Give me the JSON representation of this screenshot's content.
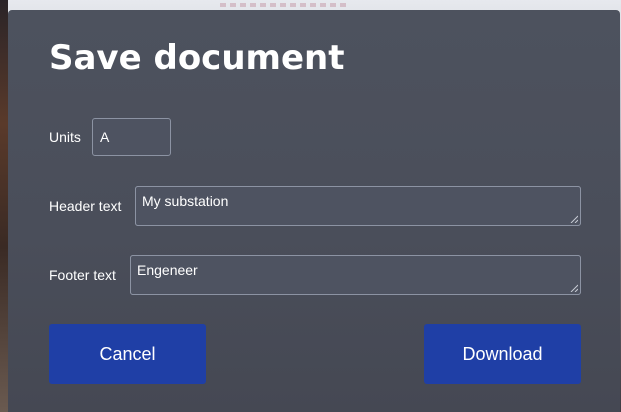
{
  "dialog": {
    "title": "Save document",
    "units": {
      "label": "Units",
      "value": "A"
    },
    "header_text": {
      "label": "Header text",
      "value": "My substation"
    },
    "footer_text": {
      "label": "Footer text",
      "value": "Engeneer"
    },
    "buttons": {
      "cancel": "Cancel",
      "download": "Download"
    }
  },
  "colors": {
    "dialog_bg": "#4b4f5b",
    "field_bg": "#4e5361",
    "field_border": "#8c93a3",
    "button_bg": "#1f3fa6",
    "text": "#ffffff"
  }
}
